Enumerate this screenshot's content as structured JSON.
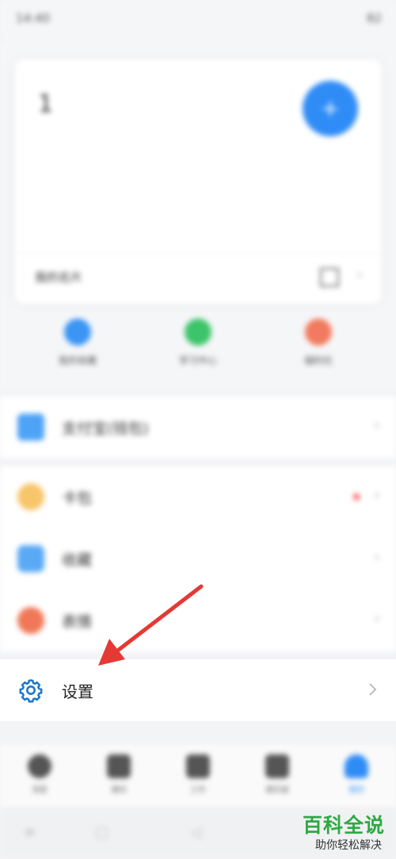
{
  "status": {
    "time": "14:40",
    "battery": "82"
  },
  "card": {
    "number": "1",
    "line1": "",
    "line2": "",
    "label": "我的名片"
  },
  "quick_actions": [
    {
      "label": "我的收藏",
      "color": "#3a95f5"
    },
    {
      "label": "学习中心",
      "color": "#3cc46a"
    },
    {
      "label": "福利社",
      "color": "#f27a5e"
    }
  ],
  "menu_group1": [
    {
      "label": "支付宝(钱包)",
      "icon": "wallet-icon",
      "color": "#4ea3f7"
    }
  ],
  "menu_group2": [
    {
      "label": "卡包",
      "icon": "coupon-icon",
      "color": "#f7c56a",
      "has_dot": true
    },
    {
      "label": "收藏",
      "icon": "collect-icon",
      "color": "#5aa9f5",
      "has_dot": false
    },
    {
      "label": "表情",
      "icon": "emoji-icon",
      "color": "#f07856",
      "has_dot": false
    }
  ],
  "settings": {
    "label": "设置",
    "icon": "gear-icon",
    "accent": "#1f78c8"
  },
  "tabs": [
    {
      "label": "消息"
    },
    {
      "label": "通讯"
    },
    {
      "label": "工作"
    },
    {
      "label": "通讯录"
    },
    {
      "label": "我的"
    }
  ],
  "watermark": {
    "title": "百科全说",
    "subtitle": "助你轻松解决"
  },
  "annotation_color": "#e53935"
}
